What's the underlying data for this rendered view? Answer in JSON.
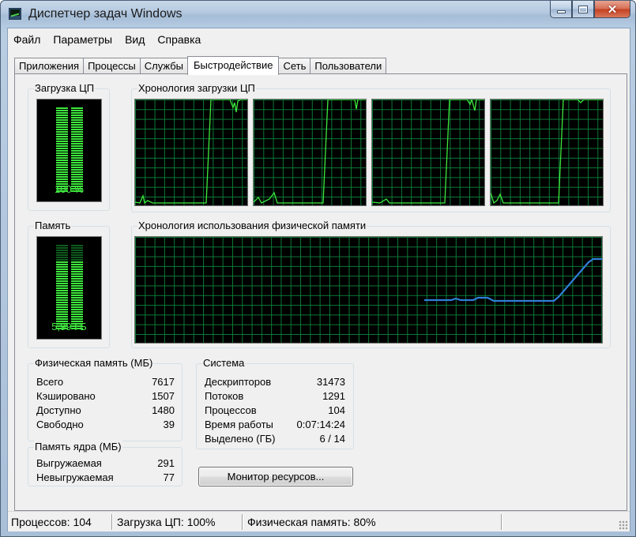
{
  "window": {
    "title": "Диспетчер задач Windows"
  },
  "menu": [
    "Файл",
    "Параметры",
    "Вид",
    "Справка"
  ],
  "tabs": [
    {
      "label": "Приложения",
      "active": false
    },
    {
      "label": "Процессы",
      "active": false
    },
    {
      "label": "Службы",
      "active": false
    },
    {
      "label": "Быстродействие",
      "active": true
    },
    {
      "label": "Сеть",
      "active": false
    },
    {
      "label": "Пользователи",
      "active": false
    }
  ],
  "cpu_meter": {
    "title": "Загрузка ЦП",
    "value_text": "100 %",
    "level": 1.0
  },
  "cpu_history": {
    "title": "Хронология загрузки ЦП",
    "core_count": 4
  },
  "mem_meter": {
    "title": "Память",
    "value_text": "5,99 ГБ",
    "level": 0.8
  },
  "mem_history": {
    "title": "Хронология использования физической памяти"
  },
  "physical_memory": {
    "title": "Физическая память (МБ)",
    "rows": [
      {
        "label": "Всего",
        "value": "7617"
      },
      {
        "label": "Кэшировано",
        "value": "1507"
      },
      {
        "label": "Доступно",
        "value": "1480"
      },
      {
        "label": "Свободно",
        "value": "39"
      }
    ]
  },
  "kernel_memory": {
    "title": "Память ядра (МБ)",
    "rows": [
      {
        "label": "Выгружаемая",
        "value": "291"
      },
      {
        "label": "Невыгружаемая",
        "value": "77"
      }
    ]
  },
  "system": {
    "title": "Система",
    "rows": [
      {
        "label": "Дескрипторов",
        "value": "31473"
      },
      {
        "label": "Потоков",
        "value": "1291"
      },
      {
        "label": "Процессов",
        "value": "104"
      },
      {
        "label": "Время работы",
        "value": "0:07:14:24"
      },
      {
        "label": "Выделено (ГБ)",
        "value": "6 / 14"
      }
    ]
  },
  "resource_monitor_button": "Монитор ресурсов...",
  "status": {
    "processes": "Процессов: 104",
    "cpu": "Загрузка ЦП: 100%",
    "memory": "Физическая память: 80%"
  },
  "colors": {
    "graph_grid": "#0c7b37",
    "cpu_line": "#3ce83c",
    "mem_line": "#2f7fd8",
    "meter_on": "#3ce83c",
    "meter_off": "#0e5a1e"
  }
}
